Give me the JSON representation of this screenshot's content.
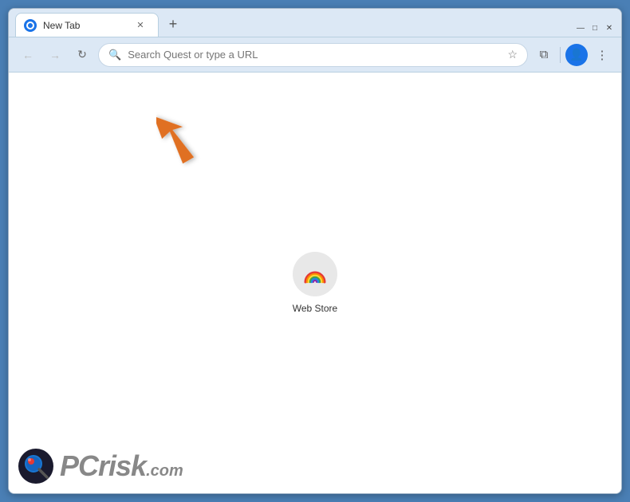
{
  "browser": {
    "tab": {
      "title": "New Tab",
      "favicon_label": "tab-favicon"
    },
    "new_tab_button": "+",
    "window_controls": {
      "minimize": "—",
      "maximize": "□",
      "close": "✕"
    },
    "nav": {
      "back_label": "←",
      "forward_label": "→",
      "reload_label": "↻",
      "address_placeholder": "Search Quest or type a URL",
      "bookmark_icon": "☆",
      "extensions_icon": "⧉",
      "profile_icon": "👤",
      "menu_icon": "⋮"
    },
    "shortcuts": [
      {
        "label": "Web Store",
        "icon": "webstore"
      }
    ]
  },
  "watermark": {
    "brand": "PC",
    "suffix": "risk",
    "domain": ".com"
  }
}
